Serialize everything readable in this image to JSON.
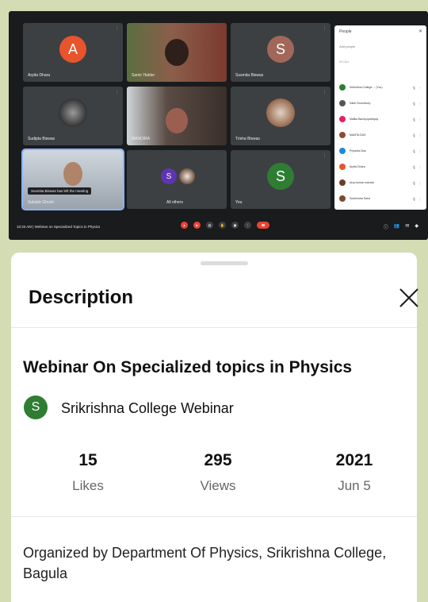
{
  "meeting": {
    "tiles": [
      {
        "name": "Arpita Dhara",
        "avatar_letter": "A",
        "avatar_color": "#e8542c",
        "kind": "letter"
      },
      {
        "name": "Samir Halder",
        "kind": "camera",
        "bg": "#6f4b3a"
      },
      {
        "name": "Susmita Biswas",
        "avatar_letter": "S",
        "avatar_color": "#a1685a",
        "kind": "letter"
      },
      {
        "name": "Sudipta Biswas",
        "kind": "photo",
        "bg": "#4a4a4a"
      },
      {
        "name": "MANDIRA",
        "kind": "camera",
        "bg": "#7a6e64"
      },
      {
        "name": "Trisha Biswas",
        "kind": "photo",
        "bg": "#8c5a3c"
      },
      {
        "name": "Sukdeb Ghosh",
        "kind": "camera",
        "bg": "#b8c2cc"
      },
      {
        "name": "All others",
        "avatar_letter": "S",
        "avatar_color": "#5e35b1",
        "kind": "letter"
      },
      {
        "name": "You",
        "avatar_letter": "S",
        "avatar_color": "#2e7d32",
        "kind": "letter"
      }
    ],
    "toast": "Susmita Biswas has left the meeting",
    "info": "10:33 AM  |  Webinar on Specialized Topics in Physics",
    "people": {
      "title": "People",
      "add": "Add people",
      "group": "IN CALL",
      "rows": [
        {
          "name": "Srikrishna College ... (You)",
          "color": "#2e7d32"
        },
        {
          "name": "Sakti Chowdhury",
          "color": "#555555"
        },
        {
          "name": "Malika Bandyopadhyay",
          "color": "#e91e63"
        },
        {
          "name": "MAMTA DAS",
          "color": "#8d4b32"
        },
        {
          "name": "Priyanka Das",
          "color": "#1e88e5"
        },
        {
          "name": "Arpita Dhara",
          "color": "#e8542c"
        },
        {
          "name": "Arup kumar mandal",
          "color": "#6a3d2a"
        },
        {
          "name": "Sukhendra Saha",
          "color": "#7b4a2e"
        }
      ]
    }
  },
  "sheet": {
    "title": "Description",
    "video_title": "Webinar On Specialized topics in Physics",
    "channel_initial": "S",
    "channel_name": "Srikrishna College Webinar",
    "stats": [
      {
        "value": "15",
        "label": "Likes"
      },
      {
        "value": "295",
        "label": "Views"
      },
      {
        "value": "2021",
        "label": "Jun 5"
      }
    ],
    "description": "Organized by Department Of Physics, Srikrishna College, Bagula"
  }
}
